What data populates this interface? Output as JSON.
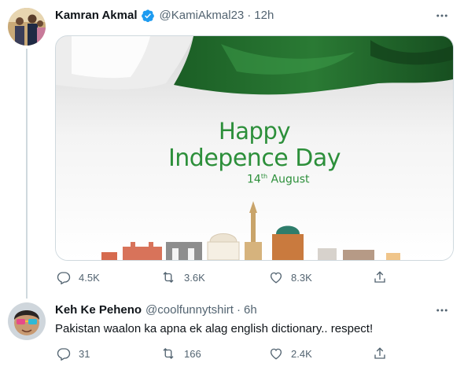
{
  "tweets": [
    {
      "author": {
        "name": "Kamran Akmal",
        "handle": "@KamiAkmal23",
        "verified": true
      },
      "time": "12h",
      "media": {
        "line1": "Happy",
        "line2": "Indepence Day",
        "date_day": "14",
        "date_suffix": "th",
        "date_month": "August"
      },
      "stats": {
        "replies": "4.5K",
        "retweets": "3.6K",
        "likes": "8.3K"
      }
    },
    {
      "author": {
        "name": "Keh Ke Peheno",
        "handle": "@coolfunnytshirt",
        "verified": false
      },
      "time": "6h",
      "text": "Pakistan waalon ka apna ek alag english dictionary.. respect!",
      "stats": {
        "replies": "31",
        "retweets": "166",
        "likes": "2.4K"
      }
    }
  ],
  "separator": "·",
  "colors": {
    "text": "#0f1419",
    "secondary": "#536471",
    "verified": "#1d9bf0",
    "flag_green": "#1f6b2c",
    "text_green": "#2c8f3a",
    "border": "#cfd9de"
  },
  "icons": [
    "verified-icon",
    "more-icon",
    "reply-icon",
    "retweet-icon",
    "like-icon",
    "share-icon"
  ]
}
